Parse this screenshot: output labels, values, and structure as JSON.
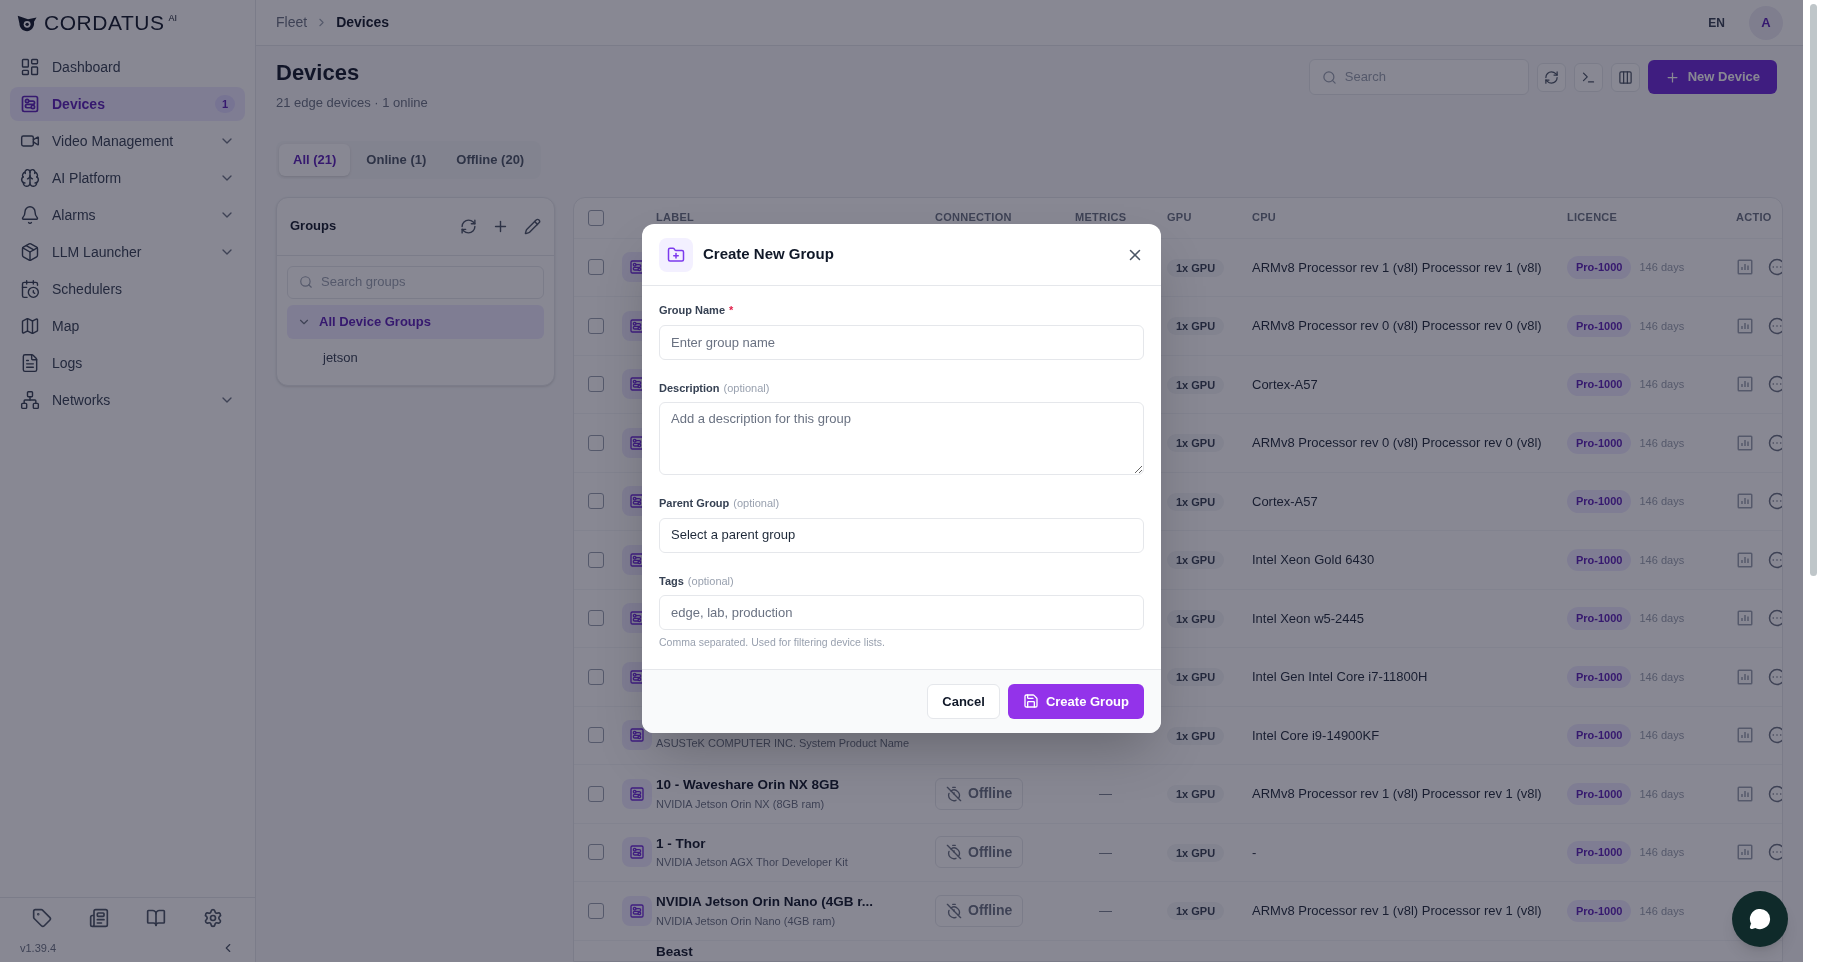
{
  "logo": {
    "name": "CORDATUS",
    "suffix": "AI"
  },
  "sidebar": {
    "items": [
      {
        "label": "Dashboard",
        "selected": false,
        "expandable": false
      },
      {
        "label": "Devices",
        "selected": true,
        "expandable": false,
        "badge": "1"
      },
      {
        "label": "Video Management",
        "selected": false,
        "expandable": true
      },
      {
        "label": "AI Platform",
        "selected": false,
        "expandable": true
      },
      {
        "label": "Alarms",
        "selected": false,
        "expandable": true
      },
      {
        "label": "LLM Launcher",
        "selected": false,
        "expandable": true
      },
      {
        "label": "Schedulers",
        "selected": false,
        "expandable": false
      },
      {
        "label": "Map",
        "selected": false,
        "expandable": false
      },
      {
        "label": "Logs",
        "selected": false,
        "expandable": false
      },
      {
        "label": "Networks",
        "selected": false,
        "expandable": true
      }
    ],
    "version": "v1.39.4"
  },
  "breadcrumb": [
    "Fleet",
    "Devices"
  ],
  "language": "EN",
  "avatar": "A",
  "page": {
    "title": "Devices",
    "subtitle": "21 edge devices · 1 online"
  },
  "search": {
    "placeholder": "Search"
  },
  "new_device_button": "New Device",
  "tabs": [
    {
      "label": "All (21)",
      "selected": true
    },
    {
      "label": "Online (1)",
      "selected": false
    },
    {
      "label": "Offline (20)",
      "selected": false
    }
  ],
  "groups": {
    "title": "Groups",
    "search_placeholder": "Search groups",
    "tree": [
      {
        "label": "All Device Groups",
        "expanded": true,
        "selected": true,
        "children": [
          {
            "label": "jetson",
            "selected": false
          }
        ]
      }
    ]
  },
  "table": {
    "columns": [
      "LABEL",
      "CONNECTION",
      "METRICS",
      "GPU",
      "CPU",
      "LICENCE",
      "ACTIO"
    ],
    "rows": [
      {
        "checked": false,
        "gpu": "1x GPU",
        "cpu": "ARMv8 Processor rev 1 (v8l) Processor rev 1 (v8l)",
        "licence": "Pro-1000",
        "days": "146 days"
      },
      {
        "checked": false,
        "gpu": "1x GPU",
        "cpu": "ARMv8 Processor rev 0 (v8l) Processor rev 0 (v8l)",
        "licence": "Pro-1000",
        "days": "146 days"
      },
      {
        "checked": false,
        "gpu": "1x GPU",
        "cpu": "Cortex-A57",
        "licence": "Pro-1000",
        "days": "146 days"
      },
      {
        "checked": false,
        "gpu": "1x GPU",
        "cpu": "ARMv8 Processor rev 0 (v8l) Processor rev 0 (v8l)",
        "licence": "Pro-1000",
        "days": "146 days"
      },
      {
        "checked": false,
        "gpu": "1x GPU",
        "cpu": "Cortex-A57",
        "licence": "Pro-1000",
        "days": "146 days"
      },
      {
        "checked": false,
        "gpu": "1x GPU",
        "cpu": "Intel Xeon Gold 6430",
        "licence": "Pro-1000",
        "days": "146 days"
      },
      {
        "checked": false,
        "gpu": "1x GPU",
        "cpu": "Intel Xeon w5-2445",
        "licence": "Pro-1000",
        "days": "146 days"
      },
      {
        "checked": false,
        "gpu": "1x GPU",
        "cpu": "Intel Gen Intel Core i7-11800H",
        "licence": "Pro-1000",
        "days": "146 days"
      },
      {
        "checked": false,
        "subtitle": "ASUSTeK COMPUTER INC. System Product Name",
        "gpu": "1x GPU",
        "cpu": "Intel Core i9-14900KF",
        "licence": "Pro-1000",
        "days": "146 days"
      },
      {
        "checked": false,
        "label": "10 - Waveshare Orin NX 8GB",
        "subtitle": "NVIDIA Jetson Orin NX (8GB ram)",
        "connection": "Offline",
        "metrics": "—",
        "gpu": "1x GPU",
        "cpu": "ARMv8 Processor rev 1 (v8l) Processor rev 1 (v8l)",
        "licence": "Pro-1000",
        "days": "146 days"
      },
      {
        "checked": false,
        "label": "1 - Thor",
        "subtitle": "NVIDIA Jetson AGX Thor Developer Kit",
        "connection": "Offline",
        "metrics": "—",
        "gpu": "1x GPU",
        "cpu": "-",
        "licence": "Pro-1000",
        "days": "146 days"
      },
      {
        "checked": false,
        "label": "NVIDIA Jetson Orin Nano (4GB r...",
        "subtitle": "NVIDIA Jetson Orin Nano (4GB ram)",
        "connection": "Offline",
        "metrics": "—",
        "gpu": "1x GPU",
        "cpu": "ARMv8 Processor rev 1 (v8l) Processor rev 1 (v8l)",
        "licence": "Pro-1000",
        "days": "146 days"
      },
      {
        "label": "Beast"
      }
    ],
    "select_all_checked": false
  },
  "dialog": {
    "title": "Create New Group",
    "fields": [
      {
        "kind": "input",
        "label": "Group Name",
        "required_mark": "*",
        "placeholder": "Enter group name"
      },
      {
        "kind": "textarea",
        "label": "Description",
        "hint": "(optional)",
        "placeholder": "Add a description for this group"
      },
      {
        "kind": "select",
        "label": "Parent Group",
        "hint": "(optional)",
        "value": "Select a parent group"
      },
      {
        "kind": "input",
        "label": "Tags",
        "hint": "(optional)",
        "placeholder": "edge, lab, production",
        "help": "Comma separated. Used for filtering device lists."
      }
    ],
    "buttons": [
      {
        "kind": "secondary",
        "label": "Cancel"
      },
      {
        "kind": "primary",
        "label": "Create Group"
      }
    ]
  }
}
